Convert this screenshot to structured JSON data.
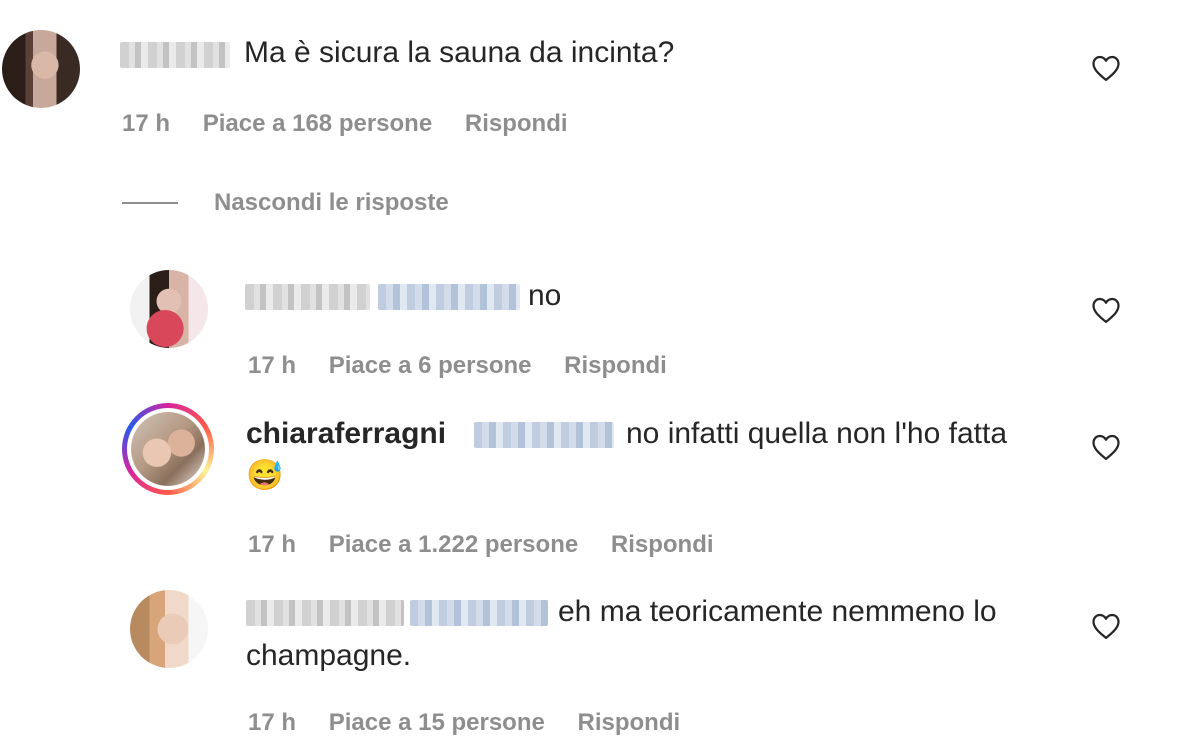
{
  "comment": {
    "text": "Ma è sicura la sauna da incinta?",
    "time": "17 h",
    "likes": "Piace a 168 persone",
    "reply": "Rispondi"
  },
  "toggle_replies": "Nascondi le risposte",
  "replies": [
    {
      "text": "no",
      "time": "17 h",
      "likes": "Piace a 6 persone",
      "reply": "Rispondi"
    },
    {
      "username": "chiaraferragni",
      "text_line1": "no infatti quella non l'ho fatta",
      "text_line2": "😅",
      "time": "17 h",
      "likes": "Piace a 1.222 persone",
      "reply": "Rispondi"
    },
    {
      "text_line1": "eh ma teoricamente nemmeno lo",
      "text_line2": "champagne.",
      "time": "17 h",
      "likes": "Piace a 15 persone",
      "reply": "Rispondi"
    }
  ],
  "icons": {
    "like": "heart-outline-icon"
  },
  "colors": {
    "text": "#262626",
    "secondary": "#8e8e8e",
    "mention_blur": "#b9c7dc"
  }
}
